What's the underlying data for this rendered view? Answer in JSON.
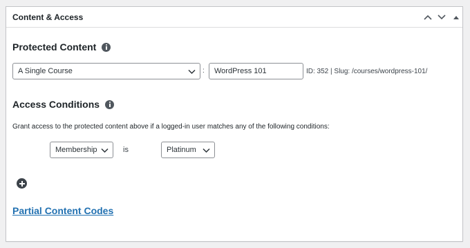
{
  "metabox": {
    "title": "Content & Access",
    "controls": [
      "chevron-up-icon",
      "chevron-down-icon",
      "triangle-up-icon"
    ]
  },
  "protected": {
    "heading": "Protected Content",
    "type_select": "A Single Course",
    "separator": ":",
    "course_input": "WordPress 101",
    "meta": "ID: 352 | Slug: /courses/wordpress-101/"
  },
  "access": {
    "heading": "Access Conditions",
    "description": "Grant access to the protected content above if a logged-in user matches any of the following conditions:",
    "condition": {
      "field": "Membership",
      "operator": "is",
      "value": "Platinum"
    }
  },
  "partial_link": "Partial Content Codes"
}
